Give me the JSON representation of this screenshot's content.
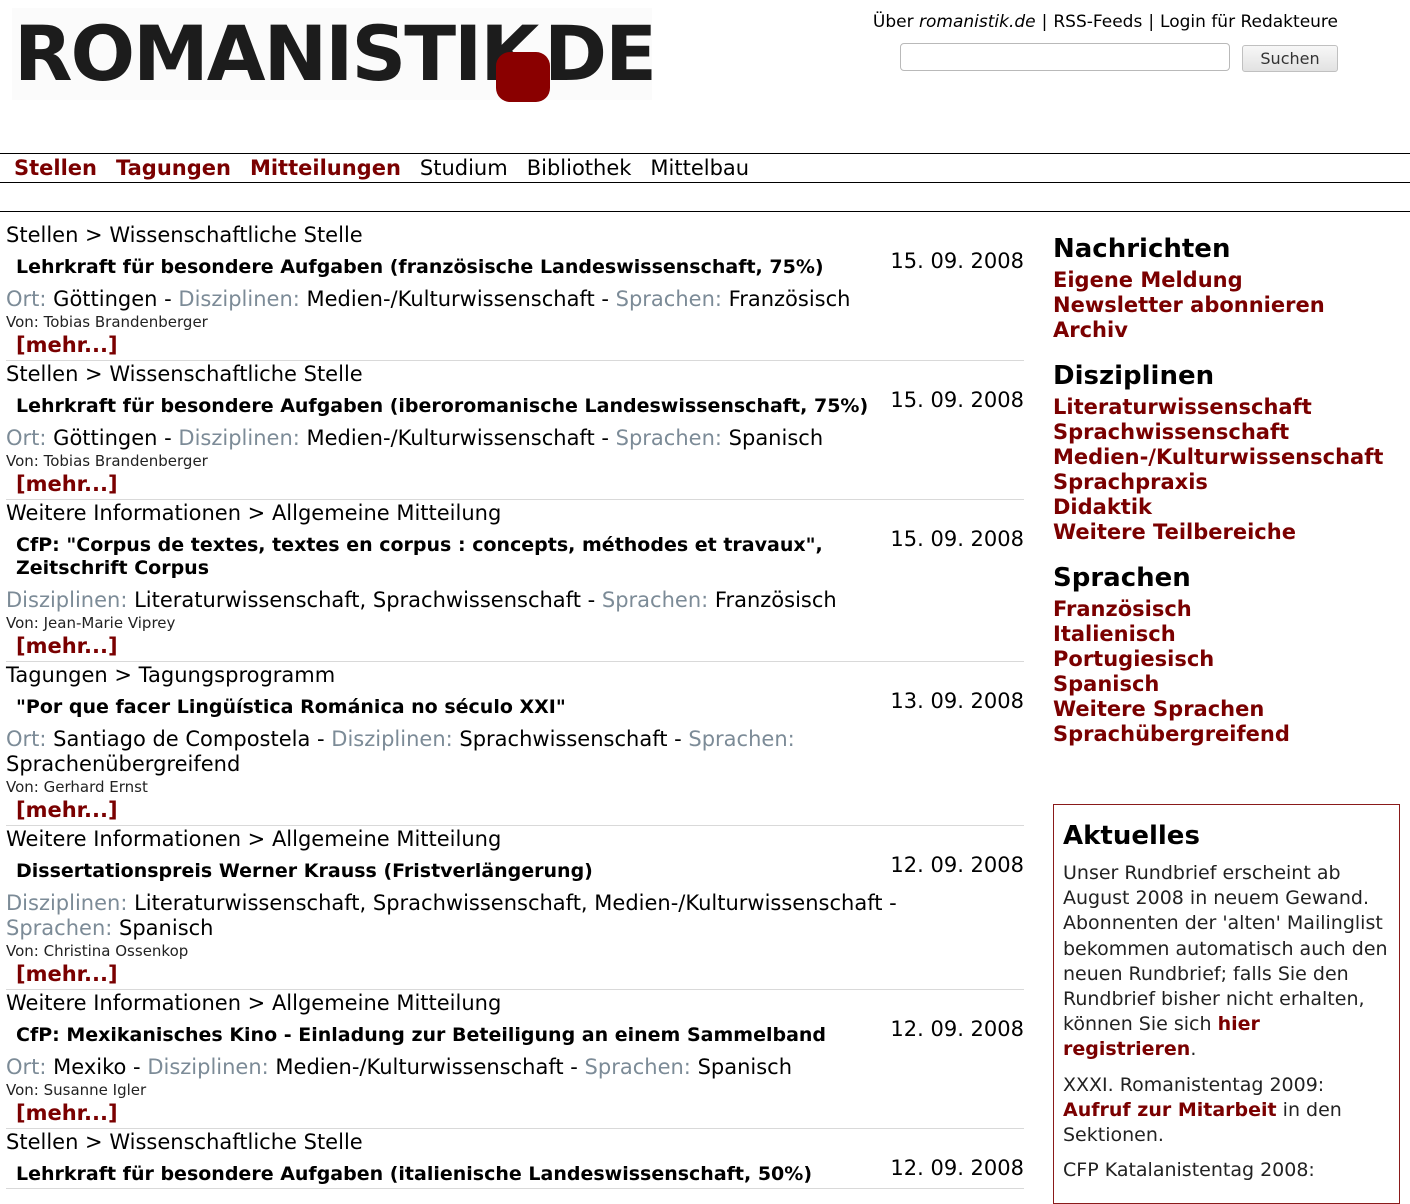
{
  "header": {
    "logo_text": "ROMANISTIK",
    "logo_suffix": "DE",
    "toplinks": {
      "about_prefix": "Über ",
      "about_site": "romanistik.de",
      "rss": "RSS-Feeds",
      "login": "Login für Redakteure",
      "separator": "|"
    },
    "search": {
      "value": "",
      "button_label": "Suchen"
    }
  },
  "nav": {
    "items": [
      {
        "label": "Stellen"
      },
      {
        "label": "Tagungen"
      },
      {
        "label": "Mitteilungen"
      },
      {
        "label": "Studium"
      },
      {
        "label": "Bibliothek"
      },
      {
        "label": "Mittelbau"
      }
    ]
  },
  "labels": {
    "ort": "Ort:",
    "disziplinen": "Disziplinen:",
    "sprachen": "Sprachen:",
    "dash": " - ",
    "von": "Von: ",
    "more": "[mehr...]"
  },
  "entries": [
    {
      "crumb": "Stellen > Wissenschaftliche Stelle",
      "date": "15. 09. 2008",
      "title": "Lehrkraft für besondere Aufgaben (französische Landeswissenschaft, 75%)",
      "ort": "Göttingen",
      "disziplinen": "Medien-/Kulturwissenschaft",
      "sprachen": "Französisch",
      "von": "Tobias Brandenberger"
    },
    {
      "crumb": "Stellen > Wissenschaftliche Stelle",
      "date": "15. 09. 2008",
      "title": "Lehrkraft für besondere Aufgaben (iberoromanische Landeswissenschaft, 75%)",
      "ort": "Göttingen",
      "disziplinen": "Medien-/Kulturwissenschaft",
      "sprachen": "Spanisch",
      "von": "Tobias Brandenberger"
    },
    {
      "crumb": "Weitere Informationen > Allgemeine Mitteilung",
      "date": "15. 09. 2008",
      "title": "CfP: \"Corpus de textes, textes en corpus : concepts, méthodes et travaux\", Zeitschrift Corpus",
      "disziplinen": "Literaturwissenschaft, Sprachwissenschaft",
      "sprachen": "Französisch",
      "von": "Jean-Marie Viprey"
    },
    {
      "crumb": "Tagungen > Tagungsprogramm",
      "date": "13. 09. 2008",
      "title": "\"Por que facer Lingüística Románica no século XXI\"",
      "ort": "Santiago de Compostela",
      "disziplinen": "Sprachwissenschaft",
      "sprachen": "Sprachenübergreifend",
      "von": "Gerhard Ernst"
    },
    {
      "crumb": "Weitere Informationen > Allgemeine Mitteilung",
      "date": "12. 09. 2008",
      "title": "Dissertationspreis Werner Krauss (Fristverlängerung)",
      "disziplinen": "Literaturwissenschaft, Sprachwissenschaft, Medien-/Kulturwissenschaft",
      "sprachen": "Spanisch",
      "von": "Christina Ossenkop"
    },
    {
      "crumb": "Weitere Informationen > Allgemeine Mitteilung",
      "date": "12. 09. 2008",
      "title": "CfP: Mexikanisches Kino - Einladung zur Beteiligung an einem Sammelband",
      "ort": "Mexiko",
      "disziplinen": "Medien-/Kulturwissenschaft",
      "sprachen": "Spanisch",
      "von": "Susanne Igler"
    },
    {
      "crumb": "Stellen > Wissenschaftliche Stelle",
      "date": "12. 09. 2008",
      "title": "Lehrkraft für besondere Aufgaben (italienische Landeswissenschaft, 50%)"
    }
  ],
  "sidebar": {
    "sections": [
      {
        "heading": "Nachrichten",
        "links": [
          "Eigene Meldung",
          "Newsletter abonnieren",
          "Archiv"
        ]
      },
      {
        "heading": "Disziplinen",
        "links": [
          "Literaturwissenschaft",
          "Sprachwissenschaft",
          "Medien-/Kulturwissenschaft",
          "Sprachpraxis",
          "Didaktik",
          "Weitere Teilbereiche"
        ]
      },
      {
        "heading": "Sprachen",
        "links": [
          "Französisch",
          "Italienisch",
          "Portugiesisch",
          "Spanisch",
          "Weitere Sprachen",
          "Sprachübergreifend"
        ]
      }
    ],
    "aktuelles": {
      "heading": "Aktuelles",
      "p1_text": "Unser Rundbrief erscheint ab August 2008 in neuem Gewand. Abonnenten der 'alten' Mailinglist bekommen automatisch auch den neuen Rundbrief; falls Sie den Rundbrief bisher nicht erhalten, können Sie sich ",
      "p1_link": "hier registrieren",
      "p1_end": ".",
      "p2_text": "XXXI. Romanistentag 2009: ",
      "p2_link": "Aufruf zur Mitarbeit",
      "p2_end": " in den Sektionen.",
      "p3_text": "CFP Katalanistentag 2008:"
    }
  },
  "colors": {
    "accent": "#7a0000",
    "label_gray": "#7c8b97",
    "logo_dot": "#8a0000"
  }
}
